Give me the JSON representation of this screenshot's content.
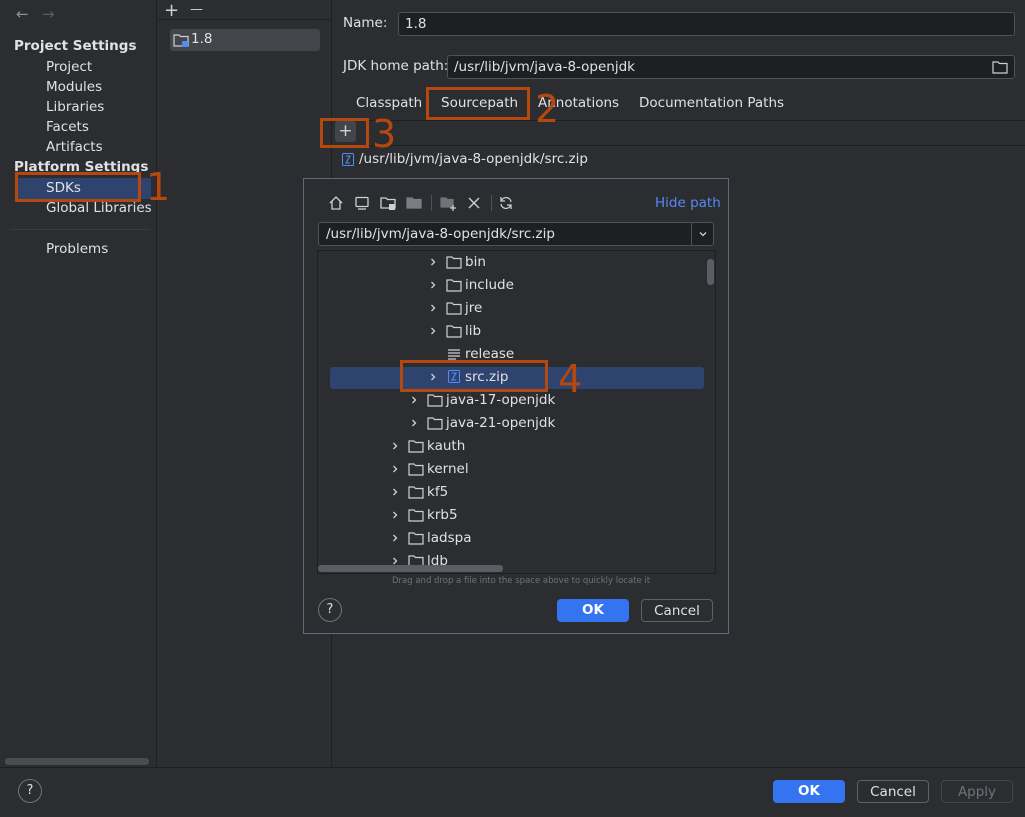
{
  "nav": {
    "back": "←",
    "forward": "→"
  },
  "sidebar": {
    "project_settings_heading": "Project Settings",
    "project_items": [
      "Project",
      "Modules",
      "Libraries",
      "Facets",
      "Artifacts"
    ],
    "platform_settings_heading": "Platform Settings",
    "sdks": "SDKs",
    "global_libraries": "Global Libraries",
    "problems": "Problems"
  },
  "sdk_list": {
    "add_symbol": "+",
    "remove_symbol": "—",
    "items": [
      "1.8"
    ]
  },
  "sdk_form": {
    "name_label": "Name:",
    "name_value": "1.8",
    "home_label": "JDK home path:",
    "home_value": "/usr/lib/jvm/java-8-openjdk",
    "tabs": [
      "Classpath",
      "Sourcepath",
      "Annotations",
      "Documentation Paths"
    ],
    "active_tab": "Sourcepath",
    "add_symbol": "+",
    "source_entries": [
      "/usr/lib/jvm/java-8-openjdk/src.zip"
    ]
  },
  "dialog": {
    "hide_path": "Hide path",
    "path_value": "/usr/lib/jvm/java-8-openjdk/src.zip",
    "toolbar_icons": [
      "home-icon",
      "desktop-icon",
      "project-folder-icon",
      "module-folder-icon",
      "new-folder-icon",
      "delete-icon",
      "refresh-icon"
    ],
    "tree": {
      "bin": "bin",
      "include": "include",
      "jre": "jre",
      "lib": "lib",
      "release": "release",
      "srczip": "src.zip",
      "java17": "java-17-openjdk",
      "java21": "java-21-openjdk",
      "kauth": "kauth",
      "kernel": "kernel",
      "kf5": "kf5",
      "krb5": "krb5",
      "ladspa": "ladspa",
      "ldb": "ldb"
    },
    "hint": "Drag and drop a file into the space above to quickly locate it",
    "ok": "OK",
    "cancel": "Cancel",
    "help": "?"
  },
  "footer": {
    "help": "?",
    "ok": "OK",
    "cancel": "Cancel",
    "apply": "Apply"
  },
  "annotations": [
    "1",
    "2",
    "3",
    "4"
  ],
  "colors": {
    "accent": "#3574f0",
    "selection": "#2e436e",
    "annotation": "#b5480f",
    "link": "#548af7"
  }
}
